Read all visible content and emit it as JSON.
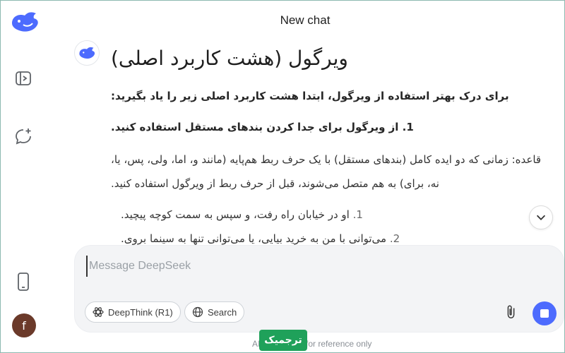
{
  "header": {
    "title": "New chat"
  },
  "message": {
    "title": "ویرگول (هشت کاربرد اصلی)",
    "intro": "برای درک بهتر استفاده از ویرگول، ابتدا هشت کاربرد اصلی زیر را یاد بگیرید:",
    "rule_heading": "1. از ویرگول برای جدا کردن بندهای مستقل استفاده کنید.",
    "rule_text": "قاعده: زمانی که دو ایده کامل (بندهای مستقل) با یک حرف ربط هم‌پایه (مانند و، اما، ولی، پس، یا، نه، برای) به هم متصل می‌شوند، قبل از حرف ربط از ویرگول استفاده کنید.",
    "examples": [
      {
        "num": "1.",
        "text": "او در خیابان راه رفت، و سپس به سمت کوچه پیچید."
      },
      {
        "num": "2.",
        "text": "می‌توانی با من به خرید بیایی، یا می‌توانی تنها به سینما بروی."
      }
    ]
  },
  "composer": {
    "placeholder": "Message DeepSeek",
    "deepthink_label": "DeepThink (R1)",
    "search_label": "Search"
  },
  "footer": {
    "disclaimer": "AI-generated, for reference only",
    "watermark": "ترجمیک"
  },
  "user": {
    "initial": "f"
  },
  "colors": {
    "accent": "#4d6bfe",
    "watermark": "#1fa15a",
    "avatar": "#6b3a2a"
  },
  "icons": {
    "logo": "whale-logo-icon",
    "sidebar": "sidebar-toggle-icon",
    "new_chat": "new-chat-icon",
    "mobile": "phone-icon",
    "deepthink": "atom-icon",
    "search": "globe-icon",
    "attach": "paperclip-icon",
    "stop": "stop-icon",
    "scroll": "chevron-down-icon"
  }
}
